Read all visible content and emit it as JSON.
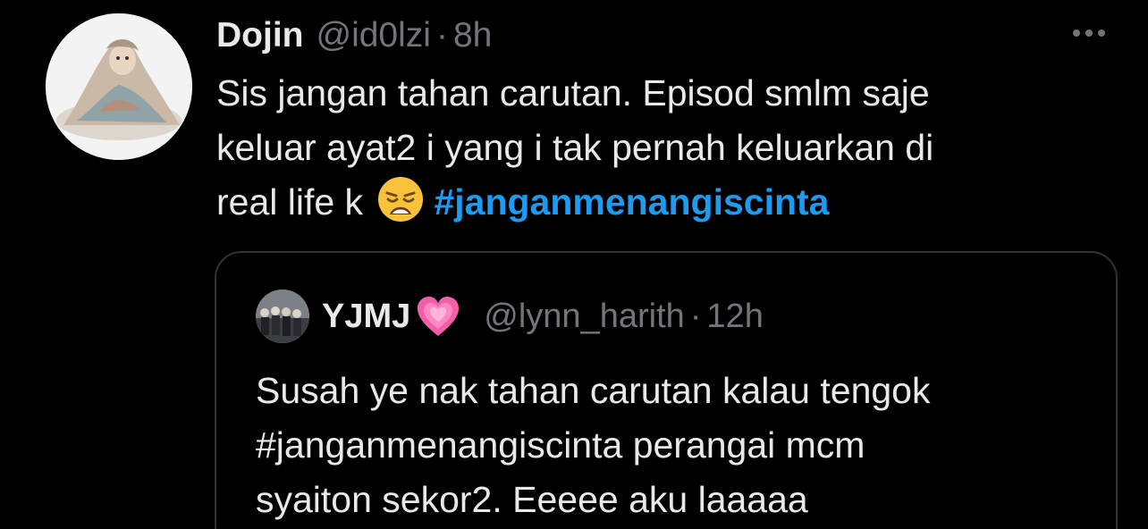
{
  "tweet": {
    "display_name": "Dojin",
    "handle": "@id0lzi",
    "separator": "·",
    "time": "8h",
    "text_line1": "Sis jangan tahan carutan. Episod smlm saje",
    "text_line2": "keluar ayat2 i yang i tak pernah keluarkan di",
    "text_line3": "real life k",
    "emoji": "weary-face-emoji",
    "hashtag": "#janganmenangiscinta",
    "hashtag_color": "#1d9bf0",
    "more_icon": "more-horizontal-icon"
  },
  "quoted_tweet": {
    "display_name": "YJMJ",
    "name_emoji": "growing-heart-emoji",
    "handle": "@lynn_harith",
    "separator": "·",
    "time": "12h",
    "text_line1": "Susah ye nak tahan carutan kalau tengok",
    "text_line2": "#janganmenangiscinta perangai mcm",
    "text_line3": "syaiton sekor2. Eeeee aku laaaaa"
  },
  "colors": {
    "background": "#000000",
    "primary_text": "#e7e9ea",
    "secondary_text": "#71767b",
    "border": "#2f3336"
  }
}
